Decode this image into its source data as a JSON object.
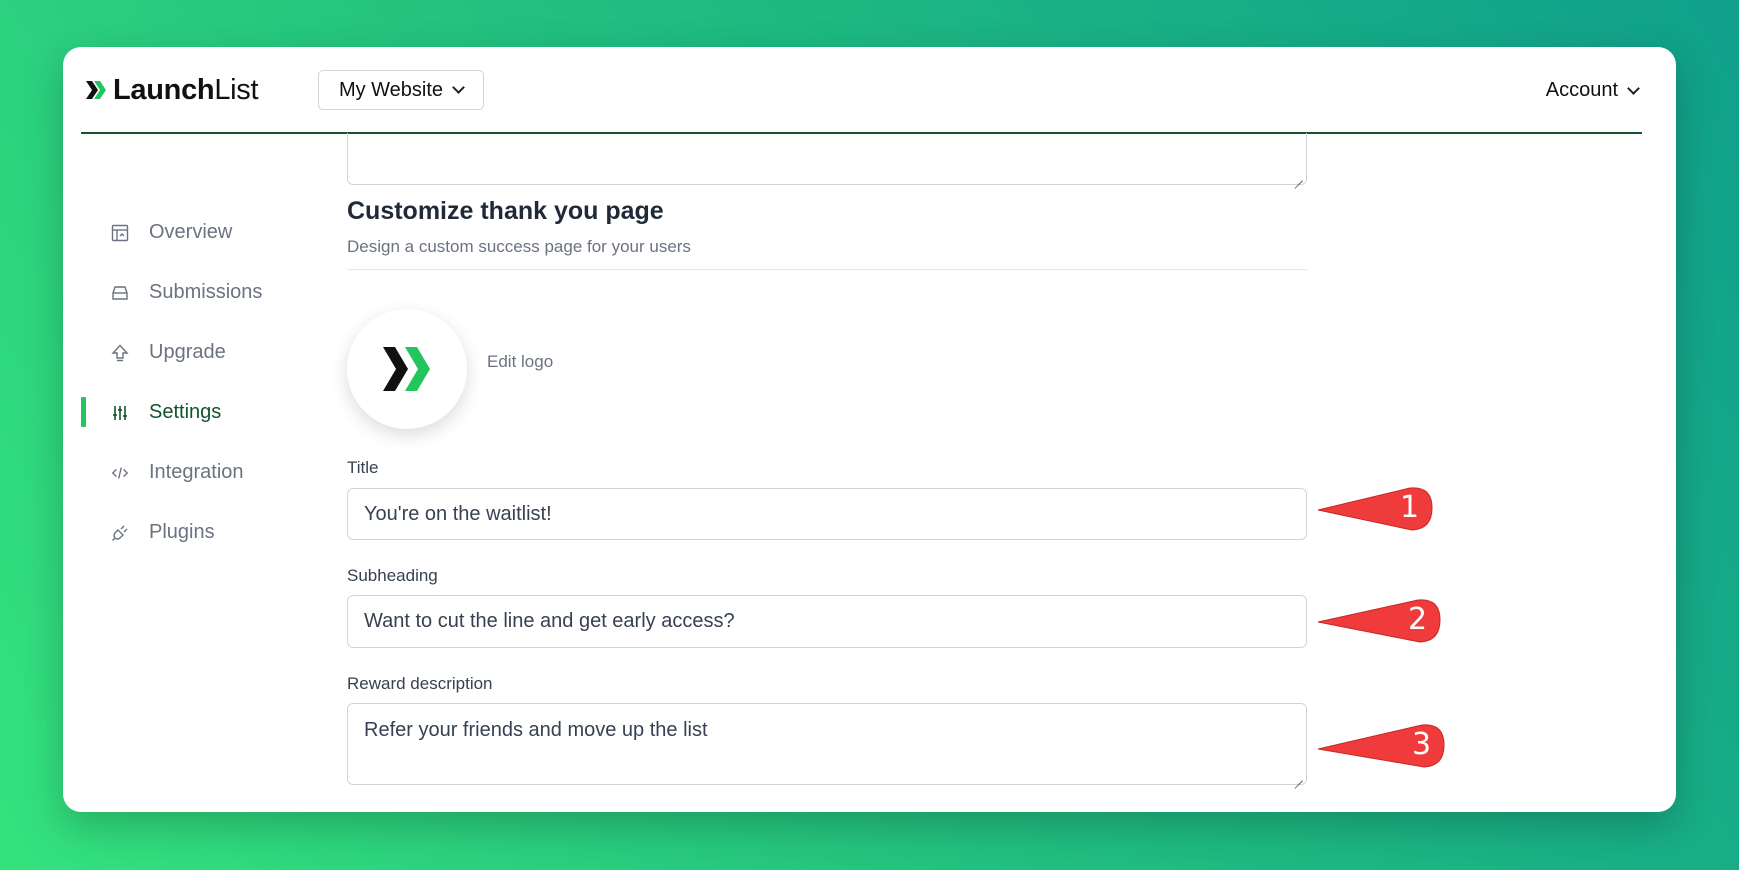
{
  "header": {
    "logo_bold": "Launch",
    "logo_light": "List",
    "site_select": "My Website",
    "account": "Account"
  },
  "sidebar": {
    "items": [
      {
        "label": "Overview",
        "icon": "overview-icon"
      },
      {
        "label": "Submissions",
        "icon": "inbox-icon"
      },
      {
        "label": "Upgrade",
        "icon": "upgrade-arrow-icon"
      },
      {
        "label": "Settings",
        "icon": "sliders-icon",
        "active": true
      },
      {
        "label": "Integration",
        "icon": "code-icon"
      },
      {
        "label": "Plugins",
        "icon": "plug-icon"
      }
    ]
  },
  "section": {
    "title": "Customize thank you page",
    "subtitle": "Design a custom success page for your users",
    "edit_logo": "Edit logo"
  },
  "fields": {
    "title_label": "Title",
    "title_value": "You're on the waitlist!",
    "subheading_label": "Subheading",
    "subheading_value": "Want to cut the line and get early access?",
    "reward_label": "Reward description",
    "reward_value": "Refer your friends and move up the list"
  },
  "annotations": [
    "1",
    "2",
    "3"
  ],
  "colors": {
    "accent": "#22c55e",
    "header_rule": "#14532d",
    "callout": "#ef3b3b"
  }
}
